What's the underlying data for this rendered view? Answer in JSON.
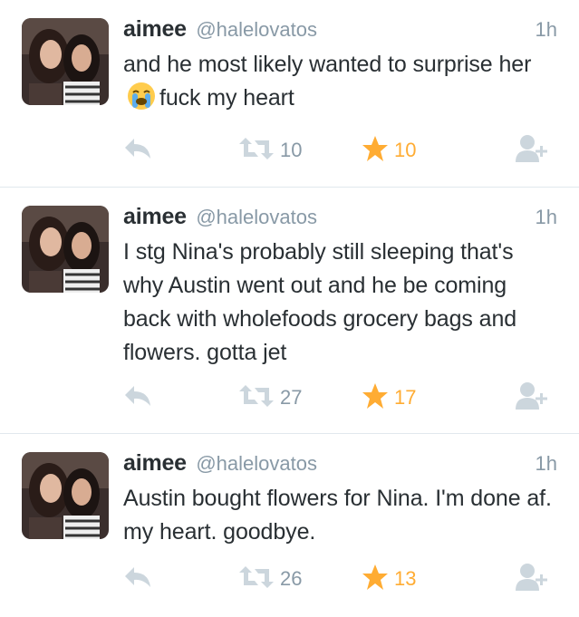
{
  "tweets": [
    {
      "name": "aimee",
      "handle": "@halelovatos",
      "time": "1h",
      "text_before": "and he most likely wanted to surprise her",
      "emoji": "loudly-crying-face",
      "text_after": "fuck my heart",
      "retweets": "10",
      "favorites": "10"
    },
    {
      "name": "aimee",
      "handle": "@halelovatos",
      "time": "1h",
      "text": "I stg Nina's probably still sleeping that's why Austin went out and he be coming back with wholefoods grocery bags and flowers. gotta jet",
      "retweets": "27",
      "favorites": "17"
    },
    {
      "name": "aimee",
      "handle": "@halelovatos",
      "time": "1h",
      "text": "Austin bought flowers for Nina. I'm done af. my heart. goodbye.",
      "retweets": "26",
      "favorites": "13"
    }
  ],
  "icons": {
    "reply": "reply-icon",
    "retweet": "retweet-icon",
    "favorite": "star-icon",
    "follow": "follow-user-icon"
  },
  "colors": {
    "text": "#292f33",
    "secondary": "#8899a6",
    "icon": "#ccd6dd",
    "favorite": "#ffac33",
    "divider": "#e1e8ed"
  }
}
